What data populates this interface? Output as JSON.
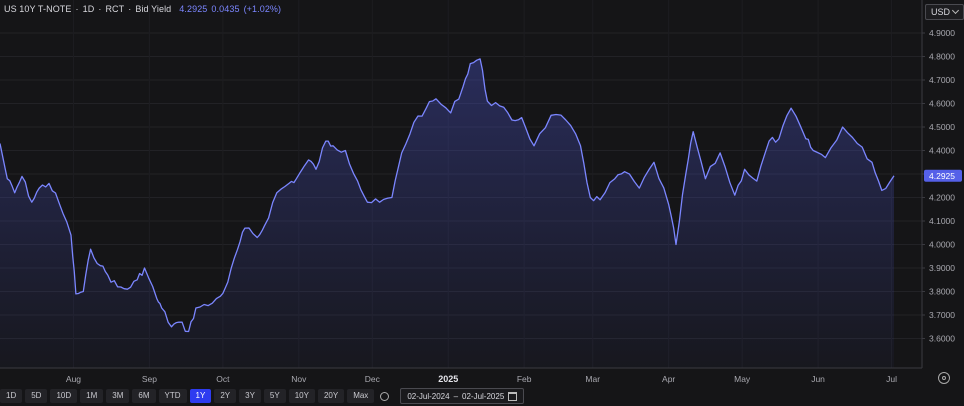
{
  "legend": {
    "symbol": "US 10Y T-NOTE",
    "interval": "1D",
    "source": "RCT",
    "price_type": "Bid Yield",
    "last": "4.2925",
    "change": "0.0435",
    "change_pct": "(+1.02%)"
  },
  "currency": "USD",
  "ranges": [
    "1D",
    "5D",
    "10D",
    "1M",
    "3M",
    "6M",
    "YTD",
    "1Y",
    "2Y",
    "3Y",
    "5Y",
    "10Y",
    "20Y",
    "Max"
  ],
  "active_range": "1Y",
  "date_range": {
    "from": "02-Jul-2024",
    "separator": "–",
    "to": "02-Jul-2025"
  },
  "colors": {
    "line": "#7b86ff",
    "active": "#2e3cf0",
    "background": "#151517"
  },
  "chart_data": {
    "type": "area",
    "title": "US 10Y T-NOTE",
    "xlabel": "",
    "ylabel": "",
    "ylim": [
      3.5,
      5.0
    ],
    "y_ticks": [
      "4.9000",
      "4.8000",
      "4.7000",
      "4.6000",
      "4.5000",
      "4.4000",
      "4.3000",
      "4.2000",
      "4.1000",
      "4.0000",
      "3.9000",
      "3.8000",
      "3.7000",
      "3.6000"
    ],
    "x_labels": [
      "Aug",
      "Sep",
      "Oct",
      "Nov",
      "Dec",
      "2025",
      "Feb",
      "Mar",
      "Apr",
      "May",
      "Jun",
      "Jul"
    ],
    "grid": true,
    "legend_position": "top-left",
    "last_value": "4.2925",
    "series": [
      {
        "x": [
          "2024-07-02",
          "2024-07-05",
          "2024-07-08",
          "2024-07-11",
          "2024-07-15",
          "2024-07-18",
          "2024-07-22",
          "2024-07-26",
          "2024-07-31",
          "2024-08-02",
          "2024-08-05",
          "2024-08-08",
          "2024-08-12",
          "2024-08-15",
          "2024-08-19",
          "2024-08-23",
          "2024-08-27",
          "2024-08-30",
          "2024-09-04",
          "2024-09-06",
          "2024-09-10",
          "2024-09-13",
          "2024-09-17",
          "2024-09-20",
          "2024-09-25",
          "2024-09-30",
          "2024-10-03",
          "2024-10-07",
          "2024-10-10",
          "2024-10-15",
          "2024-10-18",
          "2024-10-23",
          "2024-10-28",
          "2024-10-31",
          "2024-11-05",
          "2024-11-08",
          "2024-11-12",
          "2024-11-15",
          "2024-11-20",
          "2024-11-25",
          "2024-11-29",
          "2024-12-04",
          "2024-12-09",
          "2024-12-13",
          "2024-12-18",
          "2024-12-23",
          "2024-12-27",
          "2025-01-02",
          "2025-01-07",
          "2025-01-10",
          "2025-01-14",
          "2025-01-17",
          "2025-01-22",
          "2025-01-27",
          "2025-01-31",
          "2025-02-05",
          "2025-02-12",
          "2025-02-18",
          "2025-02-24",
          "2025-02-28",
          "2025-03-04",
          "2025-03-10",
          "2025-03-14",
          "2025-03-20",
          "2025-03-26",
          "2025-04-01",
          "2025-04-04",
          "2025-04-08",
          "2025-04-11",
          "2025-04-16",
          "2025-04-22",
          "2025-04-28",
          "2025-05-02",
          "2025-05-07",
          "2025-05-12",
          "2025-05-16",
          "2025-05-21",
          "2025-05-27",
          "2025-05-30",
          "2025-06-04",
          "2025-06-11",
          "2025-06-17",
          "2025-06-23",
          "2025-06-27",
          "2025-07-02"
        ],
        "y": [
          4.43,
          4.28,
          4.22,
          4.29,
          4.18,
          4.24,
          4.26,
          4.18,
          4.04,
          3.79,
          3.8,
          3.98,
          3.91,
          3.87,
          3.82,
          3.81,
          3.85,
          3.9,
          3.77,
          3.73,
          3.65,
          3.67,
          3.63,
          3.73,
          3.74,
          3.78,
          3.84,
          3.98,
          4.07,
          4.03,
          4.08,
          4.22,
          4.26,
          4.28,
          4.36,
          4.32,
          4.44,
          4.42,
          4.4,
          4.27,
          4.18,
          4.18,
          4.2,
          4.39,
          4.52,
          4.58,
          4.62,
          4.56,
          4.67,
          4.77,
          4.79,
          4.61,
          4.59,
          4.53,
          4.54,
          4.42,
          4.55,
          4.53,
          4.42,
          4.2,
          4.19,
          4.28,
          4.31,
          4.24,
          4.35,
          4.17,
          4.0,
          4.3,
          4.48,
          4.28,
          4.39,
          4.21,
          4.32,
          4.27,
          4.44,
          4.45,
          4.58,
          4.45,
          4.4,
          4.37,
          4.5,
          4.43,
          4.35,
          4.23,
          4.2925
        ]
      }
    ]
  }
}
